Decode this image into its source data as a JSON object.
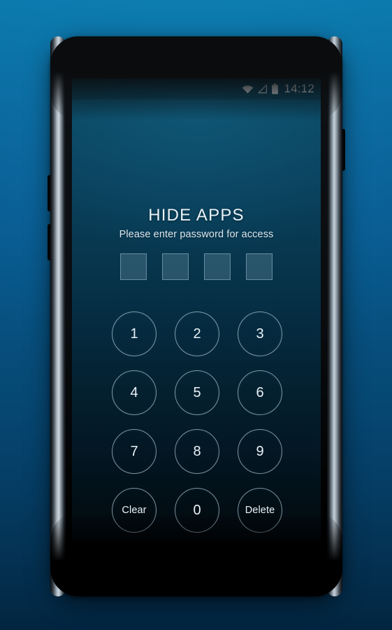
{
  "wallpaper": {
    "top_color": "#0b79ac",
    "bottom_color": "#022540"
  },
  "phone": {
    "hardware": {
      "camera": "front-camera",
      "sensor": "proximity-sensor",
      "speaker": "earpiece-speaker",
      "volume_up": "volume-up-key",
      "volume_down": "volume-down-key",
      "power": "power-key"
    }
  },
  "status_bar": {
    "wifi_icon": "wifi-icon",
    "signal_icon": "signal-triangle-icon",
    "battery_icon": "battery-icon",
    "time": "14:12"
  },
  "lockscreen": {
    "title": "HIDE APPS",
    "subtitle": "Please enter password for access",
    "password_length": 4,
    "password_entered": 0,
    "keypad": [
      {
        "label": "1",
        "name": "key-1",
        "type": "digit"
      },
      {
        "label": "2",
        "name": "key-2",
        "type": "digit"
      },
      {
        "label": "3",
        "name": "key-3",
        "type": "digit"
      },
      {
        "label": "4",
        "name": "key-4",
        "type": "digit"
      },
      {
        "label": "5",
        "name": "key-5",
        "type": "digit"
      },
      {
        "label": "6",
        "name": "key-6",
        "type": "digit"
      },
      {
        "label": "7",
        "name": "key-7",
        "type": "digit"
      },
      {
        "label": "8",
        "name": "key-8",
        "type": "digit"
      },
      {
        "label": "9",
        "name": "key-9",
        "type": "digit"
      },
      {
        "label": "Clear",
        "name": "key-clear",
        "type": "word"
      },
      {
        "label": "0",
        "name": "key-0",
        "type": "digit"
      },
      {
        "label": "Delete",
        "name": "key-delete",
        "type": "word"
      }
    ]
  },
  "colors": {
    "accent": "#0b79ac",
    "screen_top": "#0c4a63",
    "screen_bottom": "#01080d",
    "text": "#eaf3f8"
  }
}
